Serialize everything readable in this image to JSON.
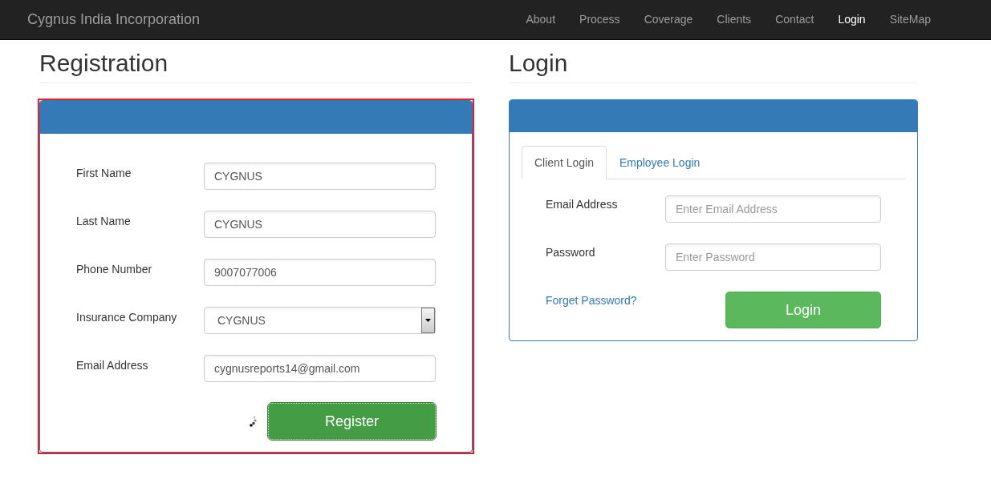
{
  "navbar": {
    "brand": "Cygnus India Incorporation",
    "items": [
      {
        "label": "About",
        "selected": false
      },
      {
        "label": "Process",
        "selected": false
      },
      {
        "label": "Coverage",
        "selected": false
      },
      {
        "label": "Clients",
        "selected": false
      },
      {
        "label": "Contact",
        "selected": false
      },
      {
        "label": "Login",
        "selected": true
      },
      {
        "label": "SiteMap",
        "selected": false
      }
    ]
  },
  "registration": {
    "title": "Registration",
    "fields": [
      {
        "kind": "text",
        "label": "First Name",
        "value": "CYGNUS"
      },
      {
        "kind": "text",
        "label": "Last Name",
        "value": "CYGNUS"
      },
      {
        "kind": "text",
        "label": "Phone Number",
        "value": "9007077006"
      },
      {
        "kind": "select",
        "label": "Insurance Company",
        "value": "CYGNUS"
      },
      {
        "kind": "text",
        "label": "Email Address",
        "value": "cygnusreports14@gmail.com"
      }
    ],
    "loading": true,
    "button": "Register"
  },
  "login": {
    "title": "Login",
    "tabs": [
      {
        "label": "Client Login",
        "selected": true
      },
      {
        "label": "Employee Login",
        "selected": false
      }
    ],
    "fields": [
      {
        "label": "Email Address",
        "placeholder": "Enter Email Address"
      },
      {
        "label": "Password",
        "placeholder": "Enter Password"
      }
    ],
    "link": "Forget Password?",
    "button": "Login"
  }
}
